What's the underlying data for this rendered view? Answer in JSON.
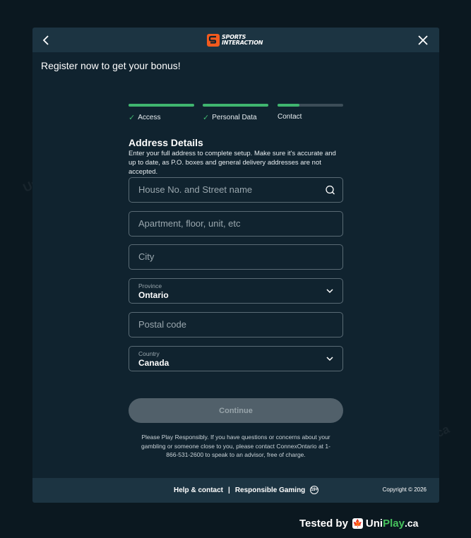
{
  "brand": {
    "line1": "SPORTS",
    "line2": "INTERACTION",
    "accent_color": "#f25a1e"
  },
  "header": {
    "back_icon": "chevron-left-icon",
    "close_icon": "close-icon"
  },
  "headline": "Register now to get your bonus!",
  "steps": [
    {
      "label": "Access",
      "done": true,
      "progress": 1.0
    },
    {
      "label": "Personal Data",
      "done": true,
      "progress": 1.0
    },
    {
      "label": "Contact",
      "done": false,
      "progress": 0.33
    }
  ],
  "section": {
    "title": "Address Details",
    "description": "Enter your full address to complete setup. Make sure it's accurate and up to date, as P.O. boxes and general delivery addresses are not accepted."
  },
  "fields": {
    "street_placeholder": "House No. and Street name",
    "apartment_placeholder": "Apartment, floor, unit, etc",
    "city_placeholder": "City",
    "province_label": "Province",
    "province_value": "Ontario",
    "postal_placeholder": "Postal code",
    "country_label": "Country",
    "country_value": "Canada"
  },
  "continue_label": "Continue",
  "disclaimer": "Please Play Responsibly. If you have questions or concerns about your gambling or someone close to you, please contact ConnexOntario at 1-866-531-2600 to speak to an advisor, free of charge.",
  "footer": {
    "help_label": "Help & contact",
    "separator": "|",
    "responsible_label": "Responsible Gaming",
    "rg_badge": "19+",
    "copyright": "Copyright © 2026"
  },
  "badge": {
    "tested_by": "Tested by",
    "uni": "Uni",
    "play": "Play",
    "ca": ".ca"
  },
  "watermark_text": "UniPlay.ca",
  "colors": {
    "page_bg": "#0b1820",
    "modal_bg": "#10232f",
    "bar_bg": "#1c3442",
    "progress": "#3fb56f",
    "button_disabled": "#51606a"
  }
}
